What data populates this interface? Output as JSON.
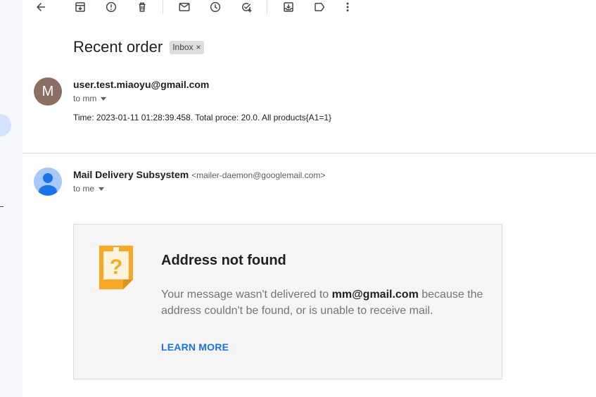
{
  "subject": "Recent order",
  "label": {
    "text": "Inbox",
    "remove": "×"
  },
  "messages": [
    {
      "avatar_letter": "M",
      "sender": "user.test.miaoyu@gmail.com",
      "to": "to mm",
      "body": "Time: 2023-01-11 01:28:39.458.  Total proce: 20.0.  All products{A1=1}"
    },
    {
      "sender": "Mail Delivery Subsystem",
      "sender_email": "<mailer-daemon@googlemail.com>",
      "to": "to me"
    }
  ],
  "bounce": {
    "title": "Address not found",
    "msg_before": "Your message wasn't delivered to ",
    "address": "mm@gmail.com",
    "msg_after": " because the address couldn't be found, or is unable to receive mail.",
    "link": "LEARN MORE"
  },
  "toolbar_icons": [
    "back-arrow-icon",
    "archive-icon",
    "report-spam-icon",
    "delete-icon",
    "mark-unread-icon",
    "snooze-icon",
    "add-task-icon",
    "move-to-icon",
    "label-icon",
    "more-vert-icon"
  ],
  "colors": {
    "avatar_m": "#8d6e63",
    "avatar_person": "#a8c7fa",
    "link": "#1a73e8",
    "sticky": "#f9a825"
  }
}
